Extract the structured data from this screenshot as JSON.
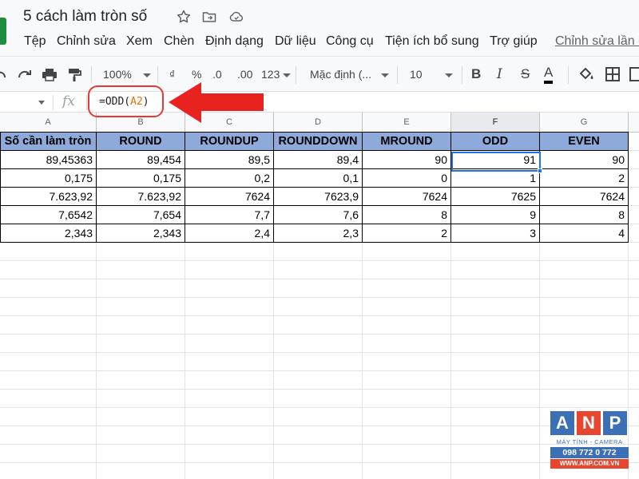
{
  "doc": {
    "title": "5 cách làm tròn số"
  },
  "menu": {
    "items": [
      "Tệp",
      "Chỉnh sửa",
      "Xem",
      "Chèn",
      "Định dạng",
      "Dữ liệu",
      "Công cụ",
      "Tiện ích bổ sung",
      "Trợ giúp"
    ],
    "last_edit": "Chỉnh sửa lần c"
  },
  "toolbar": {
    "zoom": "100%",
    "currency": "₫",
    "percent": "%",
    "dec_less": ".0",
    "dec_more": ".00",
    "format_more": "123",
    "font": "Mặc định (...",
    "font_size": "10",
    "bold": "B",
    "italic": "I",
    "strike": "S",
    "text_color": "A",
    "icons": [
      "undo-icon",
      "redo-icon",
      "print-icon",
      "paint-format-icon",
      "fill-color-icon",
      "borders-icon",
      "merge-cells-icon"
    ]
  },
  "formula_bar": {
    "fx": "fx",
    "prefix": "=ODD(",
    "ref": "A2",
    "suffix": ")"
  },
  "columns": [
    "A",
    "B",
    "C",
    "D",
    "E",
    "F",
    "G"
  ],
  "table": {
    "headers": [
      "Số cần làm tròn",
      "ROUND",
      "ROUNDUP",
      "ROUNDDOWN",
      "MROUND",
      "ODD",
      "EVEN"
    ],
    "rows": [
      [
        "89,45363",
        "89,454",
        "89,5",
        "89,4",
        "90",
        "91",
        "90"
      ],
      [
        "0,175",
        "0,175",
        "0,2",
        "0,1",
        "0",
        "1",
        "2"
      ],
      [
        "7.623,92",
        "7.623,92",
        "7624",
        "7623,9",
        "7624",
        "7625",
        "7624"
      ],
      [
        "7,6542",
        "7,654",
        "7,7",
        "7,6",
        "8",
        "9",
        "8"
      ],
      [
        "2,343",
        "2,343",
        "2,4",
        "2,3",
        "2",
        "3",
        "4"
      ]
    ],
    "header_fill": "#8eaadb"
  },
  "watermark": {
    "letters": [
      "A",
      "N",
      "P"
    ],
    "letter_colors": [
      "#3b6fb6",
      "#e8452f",
      "#3b6fb6"
    ],
    "tagline": "MÁY TÍNH - CAMERA",
    "phone": "098 772 0 772",
    "web": "WWW.ANP.COM.VN"
  }
}
